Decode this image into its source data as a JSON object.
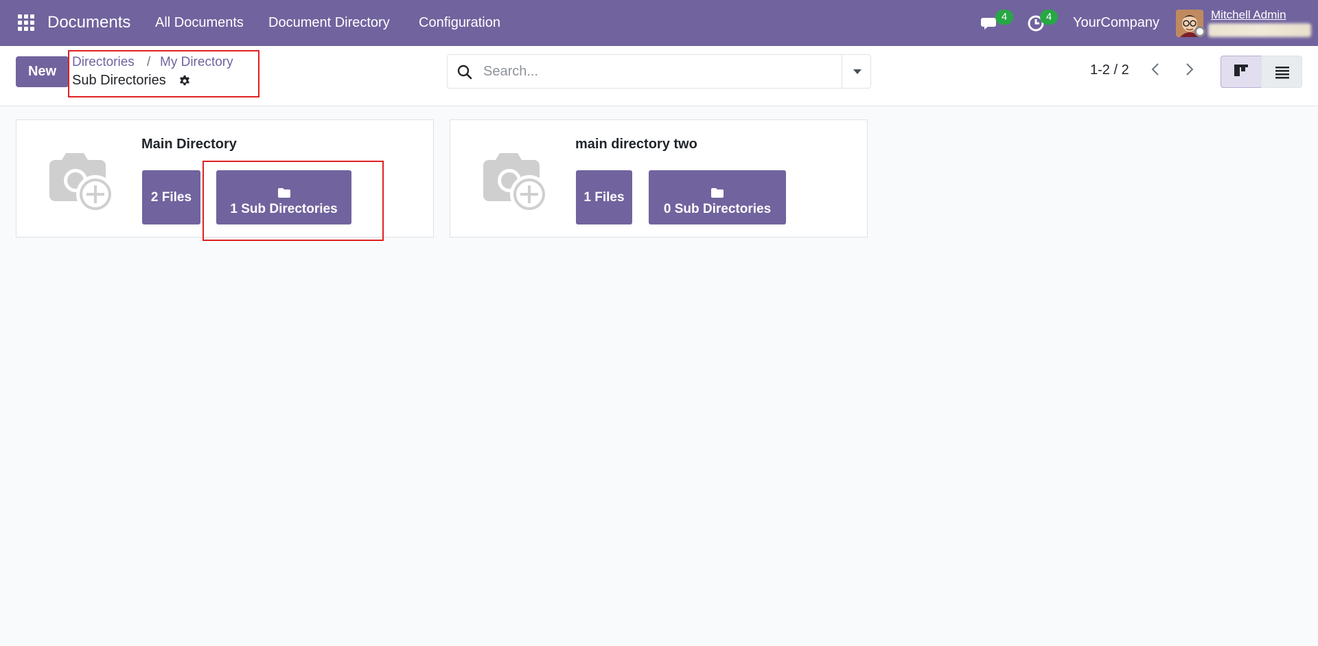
{
  "navbar": {
    "app_title": "Documents",
    "menu": [
      "All Documents",
      "Document Directory",
      "Configuration"
    ],
    "messages_count": "4",
    "activities_count": "4",
    "company": "YourCompany",
    "user": "Mitchell Admin"
  },
  "control_panel": {
    "new_label": "New",
    "breadcrumb": [
      "Directories",
      "My Directory"
    ],
    "breadcrumb_separator": "/",
    "title": "Sub Directories",
    "search_placeholder": "Search...",
    "pager": "1-2 / 2"
  },
  "cards": [
    {
      "title": "Main Directory",
      "files_label": "2 Files",
      "subdirs_label": "1 Sub Directories"
    },
    {
      "title": "main directory two",
      "files_label": "1 Files",
      "subdirs_label": "0 Sub Directories"
    }
  ],
  "colors": {
    "brand": "#71639e",
    "badge": "#28a745",
    "highlight": "#e02020"
  }
}
